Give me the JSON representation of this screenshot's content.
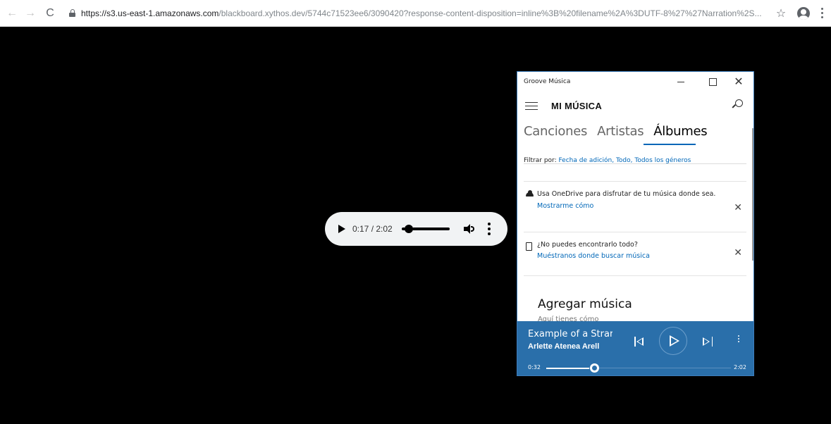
{
  "browser": {
    "url_host": "https://s3.us-east-1.amazonaws.com",
    "url_path": "/blackboard.xythos.dev/5744c71523ee6/3090420?response-content-disposition=inline%3B%20filename%2A%3DUTF-8%27%27Narration%2S..."
  },
  "audio_player": {
    "time": "0:17 / 2:02",
    "progress": 0.14
  },
  "groove": {
    "window_title": "Groove Música",
    "header_title": "MI MÚSICA",
    "tabs": [
      "Canciones",
      "Artistas",
      "Álbumes"
    ],
    "active_tab": 2,
    "filter_label": "Filtrar por: ",
    "filter_value": "Fecha de adición, Todo, Todos los géneros",
    "onedrive_text": "Usa OneDrive para disfrutar de tu música donde sea.",
    "onedrive_link": "Mostrarme cómo",
    "find_text": "¿No puedes encontrarlo todo?",
    "find_link": "Muéstranos donde buscar música",
    "add_music_title": "Agregar música",
    "add_music_subtitle": "Aquí tienes cómo",
    "now_playing": {
      "track": "Example of a Strar",
      "artist": "Arlette Atenea Arell",
      "current_time": "0:32",
      "total_time": "2:02",
      "progress": 0.26
    },
    "accent_color": "#0067b8",
    "bar_color": "#2a6faa"
  }
}
